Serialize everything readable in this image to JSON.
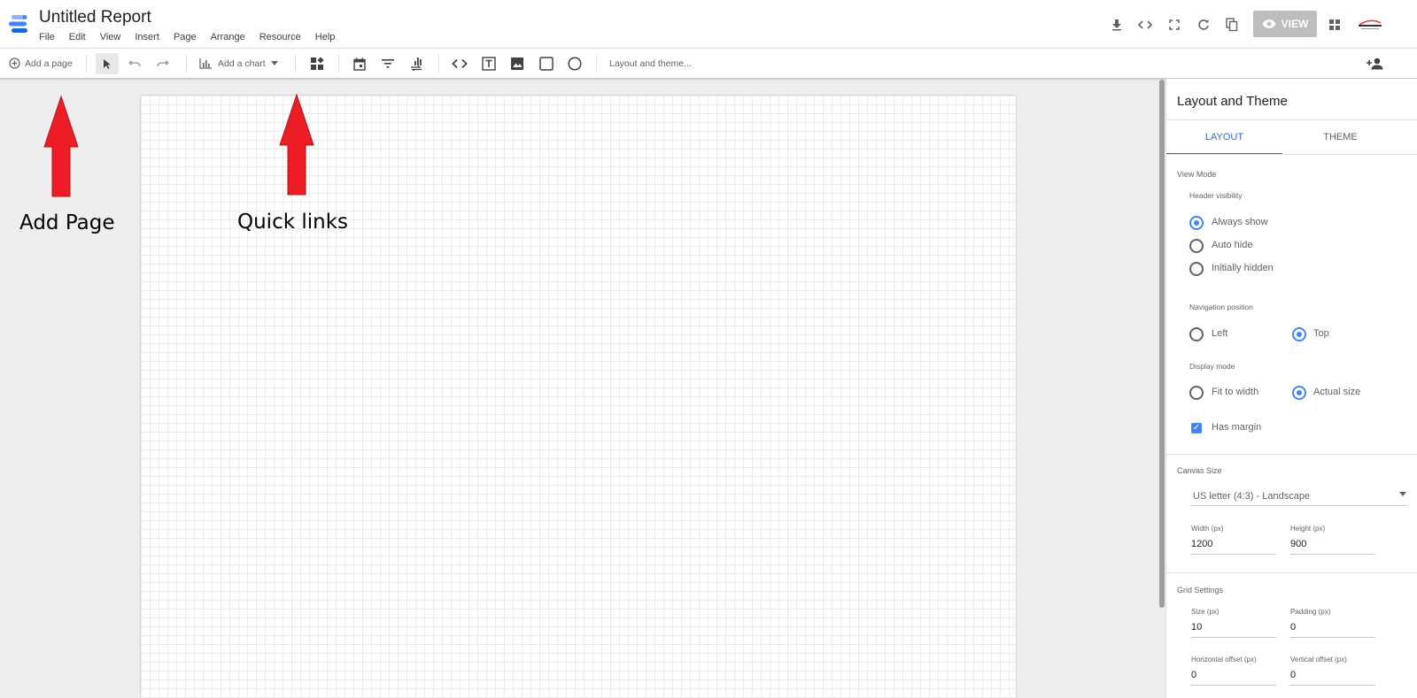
{
  "header": {
    "title": "Untitled Report",
    "menu": [
      "File",
      "Edit",
      "View",
      "Insert",
      "Page",
      "Arrange",
      "Resource",
      "Help"
    ],
    "view_label": "VIEW",
    "icons": [
      "download-icon",
      "embed-code-icon",
      "fullscreen-icon",
      "refresh-icon",
      "copy-icon",
      "eye-icon",
      "apps-grid-icon"
    ]
  },
  "toolbar": {
    "add_page_label": "Add a page",
    "add_chart_label": "Add a chart",
    "layout_theme_label": "Layout and theme...",
    "icons": [
      "add-circle-icon",
      "pointer-icon",
      "undo-icon",
      "redo-icon",
      "bar-chart-icon",
      "dropdown-caret-icon",
      "community-viz-icon",
      "date-range-icon",
      "filter-icon",
      "data-control-icon",
      "embed-url-icon",
      "text-box-icon",
      "image-icon",
      "rectangle-icon",
      "circle-icon",
      "add-person-icon"
    ]
  },
  "annotations": {
    "add_page": "Add Page",
    "quick_links": "Quick links",
    "arrow_color": "#ee1c25"
  },
  "panel": {
    "title": "Layout and Theme",
    "tabs": {
      "layout": "LAYOUT",
      "theme": "THEME"
    },
    "view_mode": {
      "title": "View Mode",
      "header_visibility": {
        "label": "Header visibility",
        "options": [
          "Always show",
          "Auto hide",
          "Initially hidden"
        ],
        "selected": "Always show"
      },
      "navigation_position": {
        "label": "Navigation position",
        "options": [
          "Left",
          "Top"
        ],
        "selected": "Top"
      },
      "display_mode": {
        "label": "Display mode",
        "options": [
          "Fit to width",
          "Actual size"
        ],
        "selected": "Actual size"
      },
      "has_margin": {
        "label": "Has margin",
        "checked": true
      }
    },
    "canvas_size": {
      "title": "Canvas Size",
      "preset": "US letter (4:3) - Landscape",
      "width_label": "Width (px)",
      "width": "1200",
      "height_label": "Height (px)",
      "height": "900"
    },
    "grid_settings": {
      "title": "Grid Settings",
      "size_label": "Size (px)",
      "size": "10",
      "padding_label": "Padding (px)",
      "padding": "0",
      "h_offset_label": "Horizontal offset (px)",
      "h_offset": "0",
      "v_offset_label": "Vertical offset (px)",
      "v_offset": "0"
    }
  },
  "colors": {
    "accent": "#4285f4",
    "tab_active": "#3367d6",
    "view_button_bg": "#bdbdbd"
  }
}
